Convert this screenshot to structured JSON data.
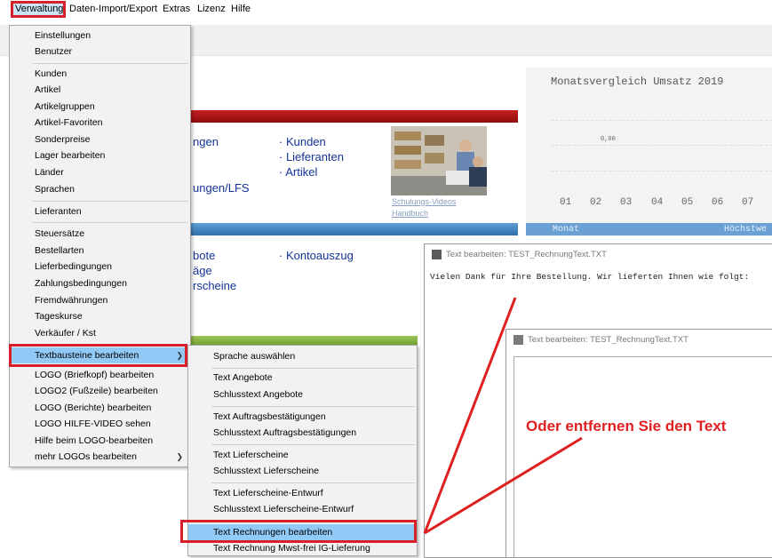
{
  "menubar": {
    "items": [
      "Verwaltung",
      "Daten-Import/Export",
      "Extras",
      "Lizenz",
      "Hilfe"
    ]
  },
  "verwaltung_menu": {
    "items": [
      "Einstellungen",
      "Benutzer",
      "Kunden",
      "Artikel",
      "Artikelgruppen",
      "Artikel-Favoriten",
      "Sonderpreise",
      "Lager bearbeiten",
      "Länder",
      "Sprachen",
      "Lieferanten",
      "Steuersätze",
      "Bestellarten",
      "Lieferbedingungen",
      "Zahlungsbedingungen",
      "Fremdwährungen",
      "Tageskurse",
      "Verkäufer / Kst",
      "Textbausteine bearbeiten",
      "LOGO (Briefkopf) bearbeiten",
      "LOGO2 (Fußzeile) bearbeiten",
      "LOGO (Berichte) bearbeiten",
      "LOGO HILFE-VIDEO sehen",
      "Hilfe beim LOGO-bearbeiten",
      "mehr LOGOs bearbeiten"
    ]
  },
  "textbausteine_menu": {
    "items": [
      "Sprache auswählen",
      "Text Angebote",
      "Schlusstext Angebote",
      "Text Auftragsbestätigungen",
      "Schlusstext Auftragsbestätigungen",
      "Text Lieferscheine",
      "Schlusstext Lieferscheine",
      "Text Lieferscheine-Entwurf",
      "Schlusstext Lieferscheine-Entwurf",
      "Text Rechnungen bearbeiten",
      "Text Rechnung Mwst-frei IG-Lieferung"
    ]
  },
  "background": {
    "links_col1": [
      "ngen",
      "ungen/LFS",
      "bote",
      "äge",
      "rscheine"
    ],
    "links_col2": [
      "· Kunden",
      "· Lieferanten",
      "· Artikel",
      "· Kontoauszug"
    ],
    "photo_links": [
      "Schulungs-Videos",
      "Handbuch"
    ]
  },
  "chart": {
    "title": "Monatsvergleich Umsatz 2019",
    "value_label": "0,00",
    "months": [
      "01",
      "02",
      "03",
      "04",
      "05",
      "06",
      "07"
    ],
    "footer_left": "Monat",
    "footer_right": "Höchstwe"
  },
  "editor1": {
    "title": "Text bearbeiten: TEST_RechnungText.TXT",
    "content": "Vielen Dank für Ihre Bestellung. Wir lieferten Ihnen wie folgt:"
  },
  "editor2": {
    "title": "Text bearbeiten: TEST_RechnungText.TXT",
    "content": ""
  },
  "annotation": {
    "text": "Oder entfernen Sie den Text",
    "color": "#e02020"
  },
  "colors": {
    "highlight": "#91c9f7",
    "annotation_red": "#d8202a",
    "link_blue": "#13339a"
  }
}
